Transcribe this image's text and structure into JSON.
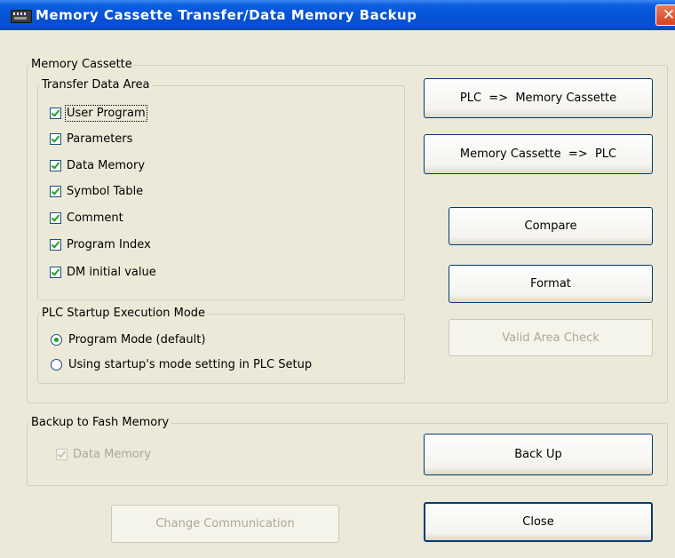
{
  "window": {
    "title": "Memory Cassette Transfer/Data Memory Backup",
    "close_glyph": "✕"
  },
  "memory_cassette": {
    "legend": "Memory Cassette",
    "transfer_area": {
      "legend": "Transfer Data Area",
      "items": [
        {
          "label": "User Program",
          "checked": true
        },
        {
          "label": "Parameters",
          "checked": true
        },
        {
          "label": "Data Memory",
          "checked": true
        },
        {
          "label": "Symbol Table",
          "checked": true
        },
        {
          "label": "Comment",
          "checked": true
        },
        {
          "label": "Program Index",
          "checked": true
        },
        {
          "label": "DM initial value",
          "checked": true
        }
      ]
    },
    "startup_mode": {
      "legend": "PLC Startup Execution Mode",
      "options": [
        {
          "label": "Program Mode (default)",
          "selected": true
        },
        {
          "label": "Using startup's mode setting in PLC Setup",
          "selected": false
        }
      ]
    },
    "buttons": {
      "plc_to_cassette": "PLC  =>  Memory Cassette",
      "cassette_to_plc": "Memory Cassette  =>  PLC",
      "compare": "Compare",
      "format": "Format",
      "valid_area_check": "Valid Area Check"
    }
  },
  "backup": {
    "legend": "Backup to Fash Memory",
    "data_memory_label": "Data Memory",
    "back_up_button": "Back Up"
  },
  "footer": {
    "change_communication": "Change Communication",
    "close": "Close"
  }
}
